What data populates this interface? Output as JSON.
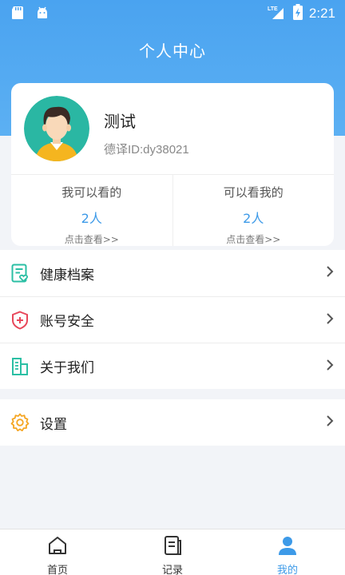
{
  "status_bar": {
    "time": "2:21",
    "network": "LTE"
  },
  "page_title": "个人中心",
  "profile": {
    "name": "测试",
    "id_text": "德译ID:dy38021",
    "stats": [
      {
        "label": "我可以看的",
        "count": "2人",
        "link": "点击查看>>"
      },
      {
        "label": "可以看我的",
        "count": "2人",
        "link": "点击查看>>"
      }
    ]
  },
  "menu": [
    {
      "label": "健康档案",
      "icon": "health-record-icon"
    },
    {
      "label": "账号安全",
      "icon": "shield-icon"
    },
    {
      "label": "关于我们",
      "icon": "building-icon"
    }
  ],
  "settings": {
    "label": "设置",
    "icon": "gear-icon"
  },
  "tabbar": [
    {
      "label": "首页",
      "icon": "home-icon",
      "active": false
    },
    {
      "label": "记录",
      "icon": "record-icon",
      "active": false
    },
    {
      "label": "我的",
      "icon": "user-icon",
      "active": true
    }
  ],
  "colors": {
    "primary": "#4aa3f0",
    "accent_blue": "#3d9ae8",
    "health_teal": "#2bbfa4",
    "shield_red": "#e8475a",
    "gear_orange": "#f5a623"
  }
}
